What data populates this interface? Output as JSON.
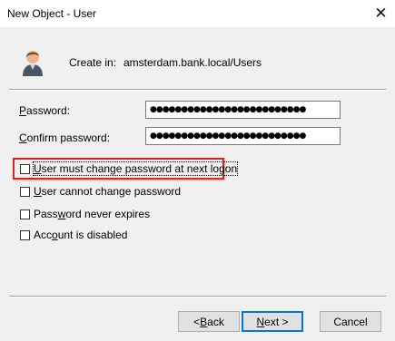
{
  "window": {
    "title": "New Object - User",
    "close_glyph": "✕"
  },
  "header": {
    "create_in_label": "Create in:",
    "create_in_path": "amsterdam.bank.local/Users",
    "icon": "user-icon"
  },
  "fields": [
    {
      "label_underlined": "P",
      "label_rest": "assword:",
      "value": "●●●●●●●●●●●●●●●●●●●●●●●●●"
    },
    {
      "label_underlined": "C",
      "label_rest": "onfirm password:",
      "value": "●●●●●●●●●●●●●●●●●●●●●●●●●"
    }
  ],
  "options": [
    {
      "label_underlined": "U",
      "label_rest": "ser must change password at next logon",
      "checked": false
    },
    {
      "label_underlined": "U",
      "label_rest": "ser cannot change password",
      "checked": false
    },
    {
      "label_pre": "Pass",
      "label_underlined": "w",
      "label_rest": "ord never expires",
      "checked": false
    },
    {
      "label_pre": "Acc",
      "label_underlined": "o",
      "label_rest": "unt is disabled",
      "checked": false
    }
  ],
  "buttons": {
    "back": {
      "pre": "< ",
      "underlined": "B",
      "rest": "ack"
    },
    "next": {
      "underlined": "N",
      "rest": "ext >"
    },
    "cancel": {
      "label": "Cancel"
    }
  },
  "colors": {
    "highlight": "#e0241b",
    "dialog_bg": "#f0f0f0",
    "default_button_border": "#0078d7"
  }
}
